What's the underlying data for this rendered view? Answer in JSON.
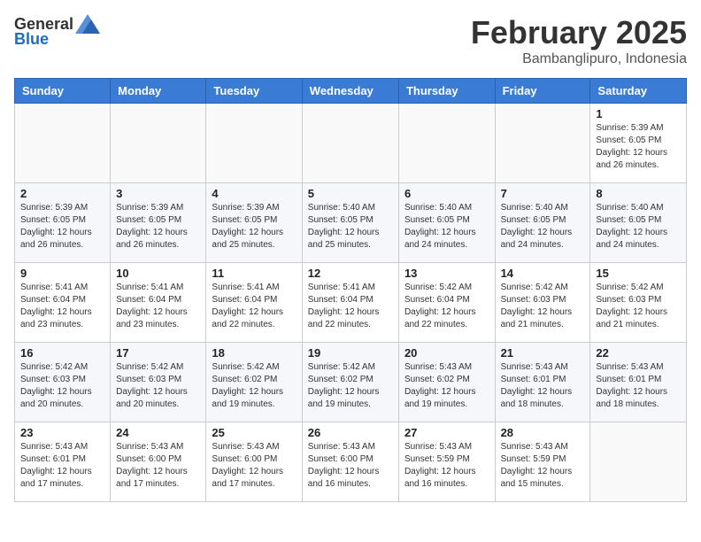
{
  "header": {
    "logo_general": "General",
    "logo_blue": "Blue",
    "title": "February 2025",
    "subtitle": "Bambanglipuro, Indonesia"
  },
  "days_of_week": [
    "Sunday",
    "Monday",
    "Tuesday",
    "Wednesday",
    "Thursday",
    "Friday",
    "Saturday"
  ],
  "weeks": [
    [
      {
        "day": "",
        "info": ""
      },
      {
        "day": "",
        "info": ""
      },
      {
        "day": "",
        "info": ""
      },
      {
        "day": "",
        "info": ""
      },
      {
        "day": "",
        "info": ""
      },
      {
        "day": "",
        "info": ""
      },
      {
        "day": "1",
        "info": "Sunrise: 5:39 AM\nSunset: 6:05 PM\nDaylight: 12 hours\nand 26 minutes."
      }
    ],
    [
      {
        "day": "2",
        "info": "Sunrise: 5:39 AM\nSunset: 6:05 PM\nDaylight: 12 hours\nand 26 minutes."
      },
      {
        "day": "3",
        "info": "Sunrise: 5:39 AM\nSunset: 6:05 PM\nDaylight: 12 hours\nand 26 minutes."
      },
      {
        "day": "4",
        "info": "Sunrise: 5:39 AM\nSunset: 6:05 PM\nDaylight: 12 hours\nand 25 minutes."
      },
      {
        "day": "5",
        "info": "Sunrise: 5:40 AM\nSunset: 6:05 PM\nDaylight: 12 hours\nand 25 minutes."
      },
      {
        "day": "6",
        "info": "Sunrise: 5:40 AM\nSunset: 6:05 PM\nDaylight: 12 hours\nand 24 minutes."
      },
      {
        "day": "7",
        "info": "Sunrise: 5:40 AM\nSunset: 6:05 PM\nDaylight: 12 hours\nand 24 minutes."
      },
      {
        "day": "8",
        "info": "Sunrise: 5:40 AM\nSunset: 6:05 PM\nDaylight: 12 hours\nand 24 minutes."
      }
    ],
    [
      {
        "day": "9",
        "info": "Sunrise: 5:41 AM\nSunset: 6:04 PM\nDaylight: 12 hours\nand 23 minutes."
      },
      {
        "day": "10",
        "info": "Sunrise: 5:41 AM\nSunset: 6:04 PM\nDaylight: 12 hours\nand 23 minutes."
      },
      {
        "day": "11",
        "info": "Sunrise: 5:41 AM\nSunset: 6:04 PM\nDaylight: 12 hours\nand 22 minutes."
      },
      {
        "day": "12",
        "info": "Sunrise: 5:41 AM\nSunset: 6:04 PM\nDaylight: 12 hours\nand 22 minutes."
      },
      {
        "day": "13",
        "info": "Sunrise: 5:42 AM\nSunset: 6:04 PM\nDaylight: 12 hours\nand 22 minutes."
      },
      {
        "day": "14",
        "info": "Sunrise: 5:42 AM\nSunset: 6:03 PM\nDaylight: 12 hours\nand 21 minutes."
      },
      {
        "day": "15",
        "info": "Sunrise: 5:42 AM\nSunset: 6:03 PM\nDaylight: 12 hours\nand 21 minutes."
      }
    ],
    [
      {
        "day": "16",
        "info": "Sunrise: 5:42 AM\nSunset: 6:03 PM\nDaylight: 12 hours\nand 20 minutes."
      },
      {
        "day": "17",
        "info": "Sunrise: 5:42 AM\nSunset: 6:03 PM\nDaylight: 12 hours\nand 20 minutes."
      },
      {
        "day": "18",
        "info": "Sunrise: 5:42 AM\nSunset: 6:02 PM\nDaylight: 12 hours\nand 19 minutes."
      },
      {
        "day": "19",
        "info": "Sunrise: 5:42 AM\nSunset: 6:02 PM\nDaylight: 12 hours\nand 19 minutes."
      },
      {
        "day": "20",
        "info": "Sunrise: 5:43 AM\nSunset: 6:02 PM\nDaylight: 12 hours\nand 19 minutes."
      },
      {
        "day": "21",
        "info": "Sunrise: 5:43 AM\nSunset: 6:01 PM\nDaylight: 12 hours\nand 18 minutes."
      },
      {
        "day": "22",
        "info": "Sunrise: 5:43 AM\nSunset: 6:01 PM\nDaylight: 12 hours\nand 18 minutes."
      }
    ],
    [
      {
        "day": "23",
        "info": "Sunrise: 5:43 AM\nSunset: 6:01 PM\nDaylight: 12 hours\nand 17 minutes."
      },
      {
        "day": "24",
        "info": "Sunrise: 5:43 AM\nSunset: 6:00 PM\nDaylight: 12 hours\nand 17 minutes."
      },
      {
        "day": "25",
        "info": "Sunrise: 5:43 AM\nSunset: 6:00 PM\nDaylight: 12 hours\nand 17 minutes."
      },
      {
        "day": "26",
        "info": "Sunrise: 5:43 AM\nSunset: 6:00 PM\nDaylight: 12 hours\nand 16 minutes."
      },
      {
        "day": "27",
        "info": "Sunrise: 5:43 AM\nSunset: 5:59 PM\nDaylight: 12 hours\nand 16 minutes."
      },
      {
        "day": "28",
        "info": "Sunrise: 5:43 AM\nSunset: 5:59 PM\nDaylight: 12 hours\nand 15 minutes."
      },
      {
        "day": "",
        "info": ""
      }
    ]
  ]
}
